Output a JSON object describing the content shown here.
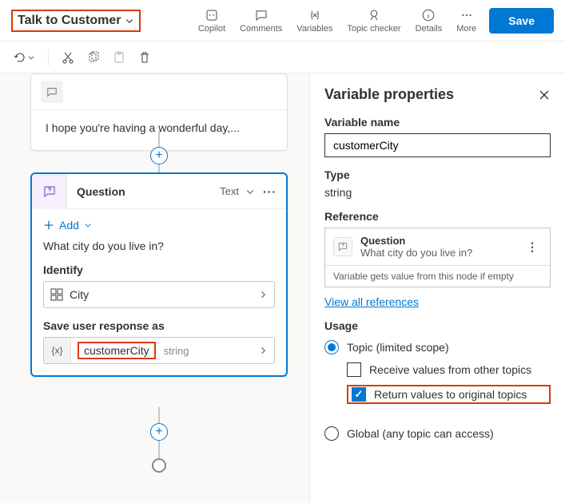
{
  "topicTitle": "Talk to Customer",
  "toolbar": {
    "copilot": "Copilot",
    "comments": "Comments",
    "variables": "Variables",
    "topicChecker": "Topic checker",
    "details": "Details",
    "more": "More",
    "save": "Save"
  },
  "canvas": {
    "message": {
      "text": "I hope you're having a wonderful day,..."
    },
    "question": {
      "title": "Question",
      "outputType": "Text",
      "addLabel": "Add",
      "prompt": "What city do you live in?",
      "identifyLabel": "Identify",
      "identifyValue": "City",
      "saveAsLabel": "Save user response as",
      "varName": "customerCity",
      "varType": "string"
    }
  },
  "panel": {
    "title": "Variable properties",
    "varNameLabel": "Variable name",
    "varNameValue": "customerCity",
    "typeLabel": "Type",
    "typeValue": "string",
    "referenceLabel": "Reference",
    "ref": {
      "title": "Question",
      "sub": "What city do you live in?",
      "footer": "Variable gets value from this node if empty"
    },
    "viewAll": "View all references",
    "usageLabel": "Usage",
    "topicScope": "Topic (limited scope)",
    "receive": "Receive values from other topics",
    "returnVals": "Return values to original topics",
    "global": "Global (any topic can access)"
  }
}
